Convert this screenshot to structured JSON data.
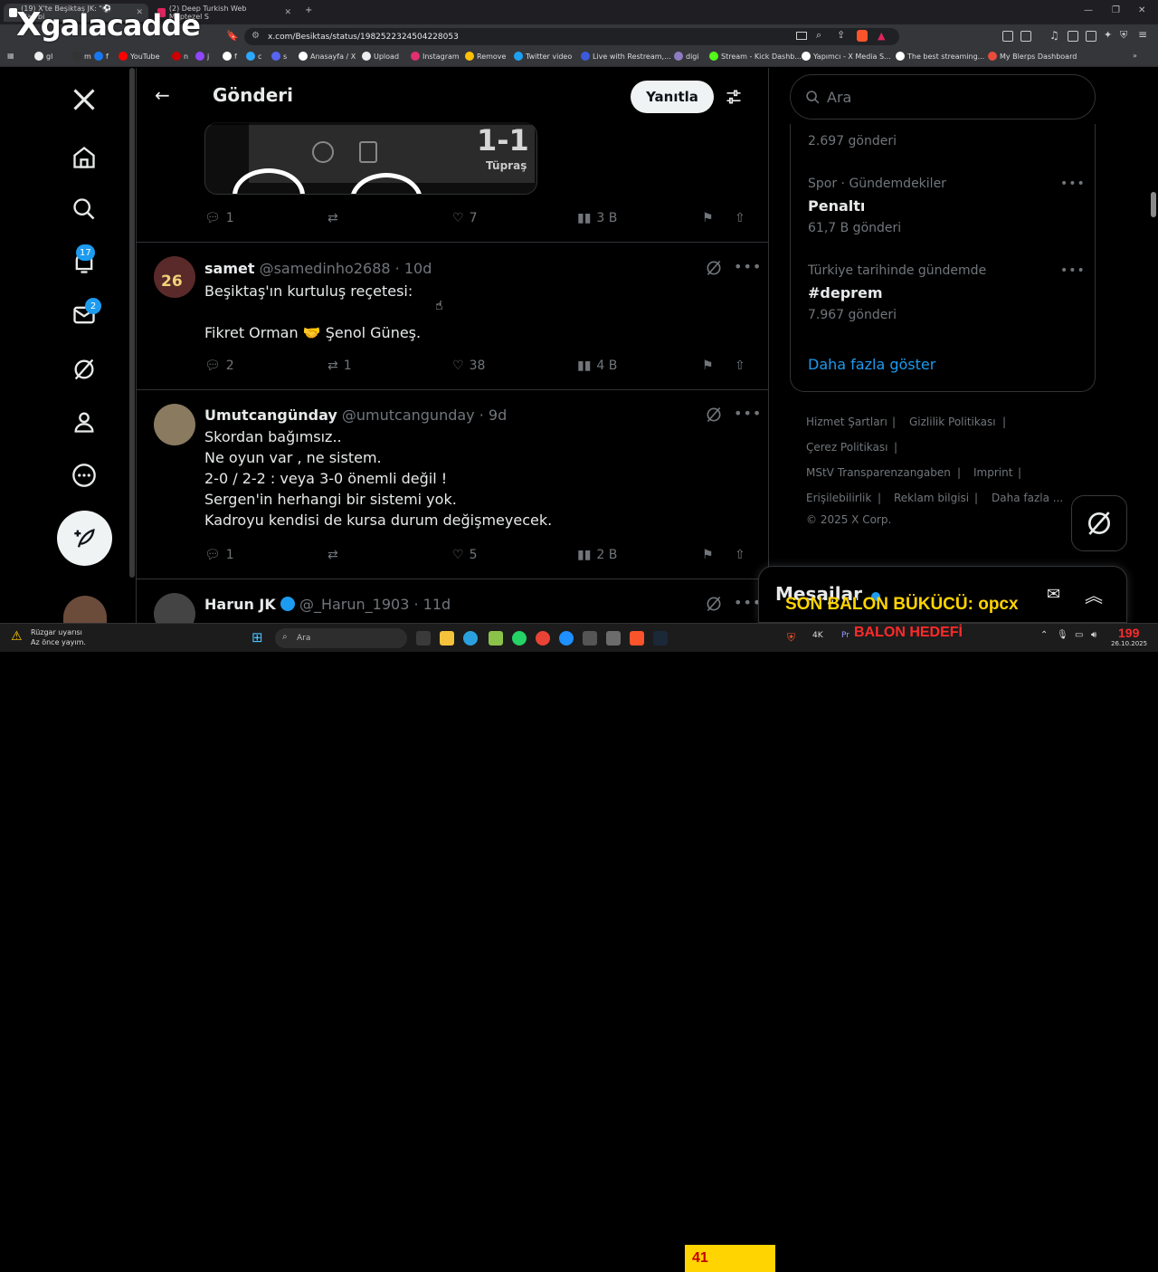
{
  "browser": {
    "tabs": [
      {
        "label": "(19) X'te Beşiktaş JK: \"⚽ Maç bi"
      },
      {
        "label": "(2) Deep Turkish Web Müptezel S"
      }
    ],
    "url": "x.com/Besiktas/status/1982522324504228053",
    "bookmarks": [
      "gl",
      "m",
      "f",
      "YouTube",
      "n",
      "j",
      "f",
      "c",
      "s",
      "Anasayfa / X",
      "Upload",
      "Instagram",
      "Remove",
      "Twitter video",
      "Live with Restream,...",
      "digi",
      "Stream - Kick Dashb...",
      "Yapımcı - X Media S...",
      "The best streaming...",
      "My Blerps Dashboard"
    ]
  },
  "overlay": {
    "logo": "galacadde",
    "banner_text": "SON BALON BÜKÜCÜ: opcx",
    "goal_label": "BALON HEDEFİ",
    "counter": "41",
    "counter_right": "199"
  },
  "nav": {
    "notifications_badge": "17",
    "messages_badge": "2"
  },
  "header": {
    "title": "Gönderi",
    "reply_label": "Yanıtla"
  },
  "media": {
    "score": "1-1",
    "sponsor": "Tüpraş"
  },
  "tweets": [
    {
      "replies": "1",
      "retweets": "",
      "likes": "7",
      "views": "3 B"
    },
    {
      "name": "samet",
      "handle": "@samedinho2688",
      "time": "· 10d",
      "text": "Beşiktaş'ın kurtuluş reçetesi:\n\nFikret Orman 🤝 Şenol Güneş.",
      "replies": "2",
      "retweets": "1",
      "likes": "38",
      "views": "4 B"
    },
    {
      "name": "Umutcangünday",
      "handle": "@umutcangunday",
      "time": "· 9d",
      "text": "Skordan bağımsız..\nNe oyun var , ne sistem.\n2-0 / 2-2 : veya 3-0 önemli değil !\nSergen'in herhangi bir sistemi yok.\nKadroyu kendisi de kursa durum değişmeyecek.",
      "replies": "1",
      "retweets": "",
      "likes": "5",
      "views": "2 B"
    },
    {
      "name": "Harun JK",
      "handle": "@_Harun_1903",
      "time": "· 11d"
    }
  ],
  "search": {
    "placeholder": "Ara"
  },
  "trends": {
    "first_count": "2.697 gönderi",
    "items": [
      {
        "meta": "Spor · Gündemdekiler",
        "name": "Penaltı",
        "count": "61,7 B gönderi"
      },
      {
        "meta": "Türkiye tarihinde gündemde",
        "name": "#deprem",
        "count": "7.967 gönderi"
      }
    ],
    "show_more": "Daha fazla göster"
  },
  "footer": {
    "links": [
      "Hizmet Şartları",
      "Gizlilik Politikası",
      "Çerez Politikası",
      "MStV Transparenzangaben",
      "Imprint",
      "Erişilebilirlik",
      "Reklam bilgisi",
      "Daha fazla ..."
    ],
    "copyright": "© 2025 X Corp."
  },
  "messages": {
    "title": "Mesajlar"
  },
  "taskbar": {
    "weather_title": "Rüzgar uyarısı",
    "weather_sub": "Az önce yayım.",
    "search": "Ara",
    "date": "26.10.2025"
  },
  "colors": {
    "accent": "#1d9bf0",
    "overlay_yellow": "#ffd400",
    "overlay_red": "#ff2a2a"
  }
}
